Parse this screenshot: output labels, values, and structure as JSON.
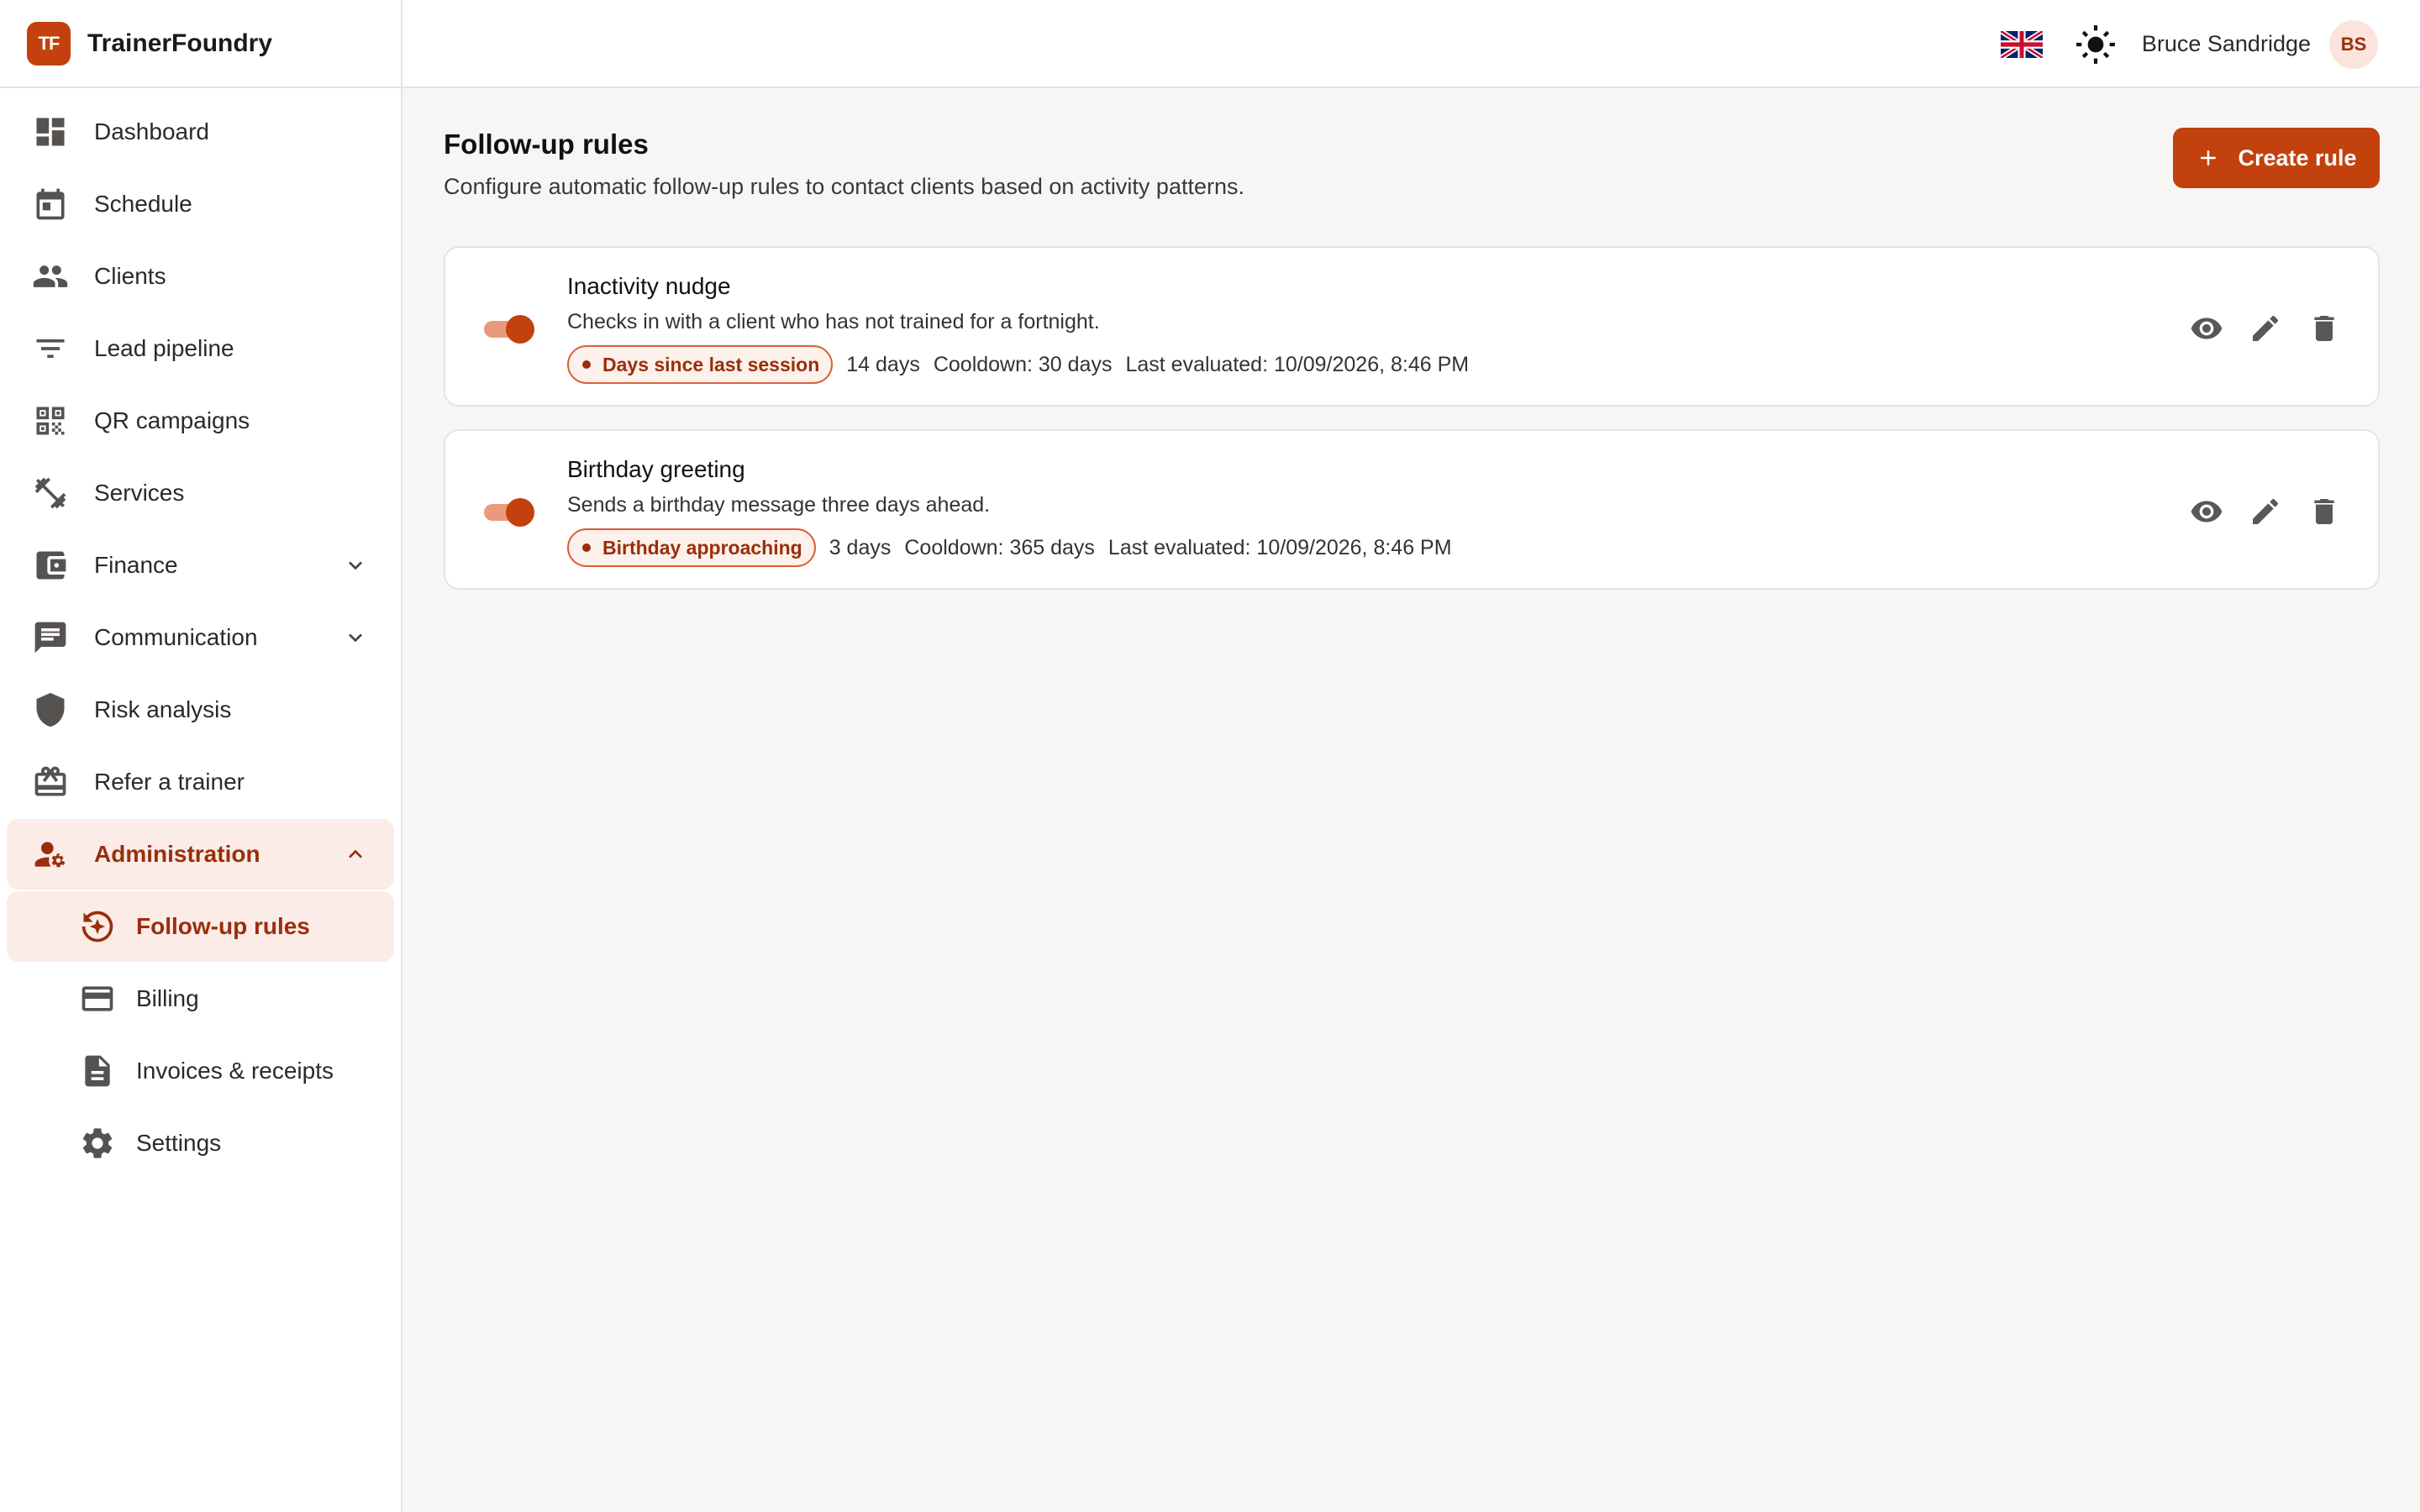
{
  "app": {
    "logo_text": "TF",
    "name": "TrainerFoundry"
  },
  "sidebar": {
    "items": [
      {
        "label": "Dashboard",
        "icon": "dashboard-icon"
      },
      {
        "label": "Schedule",
        "icon": "calendar-icon"
      },
      {
        "label": "Clients",
        "icon": "people-icon"
      },
      {
        "label": "Lead pipeline",
        "icon": "filter-icon"
      },
      {
        "label": "QR campaigns",
        "icon": "qr-code-icon"
      },
      {
        "label": "Services",
        "icon": "dumbbell-icon"
      },
      {
        "label": "Finance",
        "icon": "wallet-icon",
        "expandable": true
      },
      {
        "label": "Communication",
        "icon": "chat-icon",
        "expandable": true
      },
      {
        "label": "Risk analysis",
        "icon": "shield-icon"
      },
      {
        "label": "Refer a trainer",
        "icon": "gift-card-icon"
      },
      {
        "label": "Administration",
        "icon": "admin-icon",
        "expanded": true,
        "children": [
          {
            "label": "Follow-up rules",
            "icon": "follow-up-icon",
            "active": true
          },
          {
            "label": "Billing",
            "icon": "credit-card-icon"
          },
          {
            "label": "Invoices & receipts",
            "icon": "document-icon"
          },
          {
            "label": "Settings",
            "icon": "gear-icon"
          }
        ]
      }
    ]
  },
  "topbar": {
    "language_icon": "uk-flag-icon",
    "theme_icon": "sun-icon",
    "user_name": "Bruce Sandridge",
    "user_initials": "BS"
  },
  "page": {
    "title": "Follow-up rules",
    "subtitle": "Configure automatic follow-up rules to contact clients based on activity patterns.",
    "create_label": "Create rule"
  },
  "rules": [
    {
      "enabled": true,
      "name": "Inactivity nudge",
      "description": "Checks in with a client who has not trained for a fortnight.",
      "trigger": "Days since last session",
      "threshold": "14 days",
      "cooldown": "Cooldown: 30 days",
      "last_evaluated": "Last evaluated: 10/09/2026, 8:46 PM"
    },
    {
      "enabled": true,
      "name": "Birthday greeting",
      "description": "Sends a birthday message three days ahead.",
      "trigger": "Birthday approaching",
      "threshold": "3 days",
      "cooldown": "Cooldown: 365 days",
      "last_evaluated": "Last evaluated: 10/09/2026, 8:46 PM"
    }
  ],
  "colors": {
    "accent": "#c2410c",
    "accent_dark": "#9a2e0a",
    "accent_soft": "#fbece7"
  }
}
